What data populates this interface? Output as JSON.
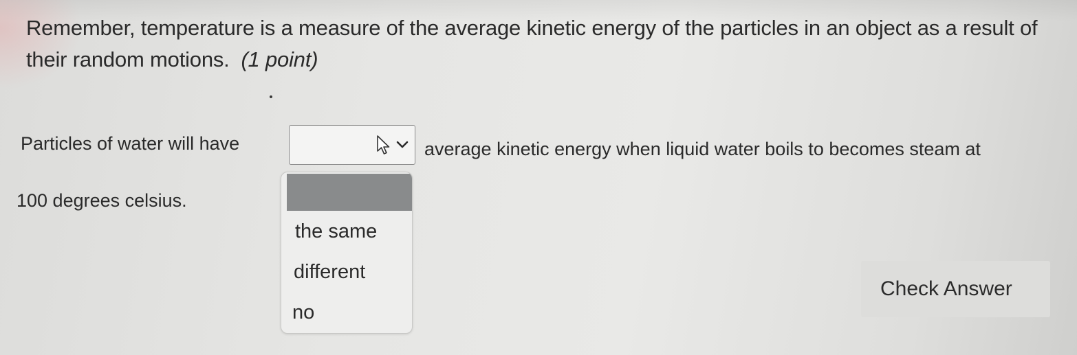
{
  "question": {
    "text": "Remember, temperature is a measure of the average kinetic energy of the particles in an object as a result of their random motions.",
    "points": "(1 point)"
  },
  "prompt": {
    "before": "Particles of water will have",
    "after": "average kinetic energy when liquid water boils to becomes steam at",
    "line2": "100 degrees celsius."
  },
  "select": {
    "value": "",
    "options": [
      "the same",
      "different",
      "no"
    ],
    "icons": [
      "cursor-arrow-icon",
      "chevron-down-icon"
    ]
  },
  "check_button": {
    "label": "Check Answer"
  },
  "colors": {
    "background": "#e6e6e4",
    "dropdown_highlight": "#898b8c",
    "button": "#dddddb"
  }
}
